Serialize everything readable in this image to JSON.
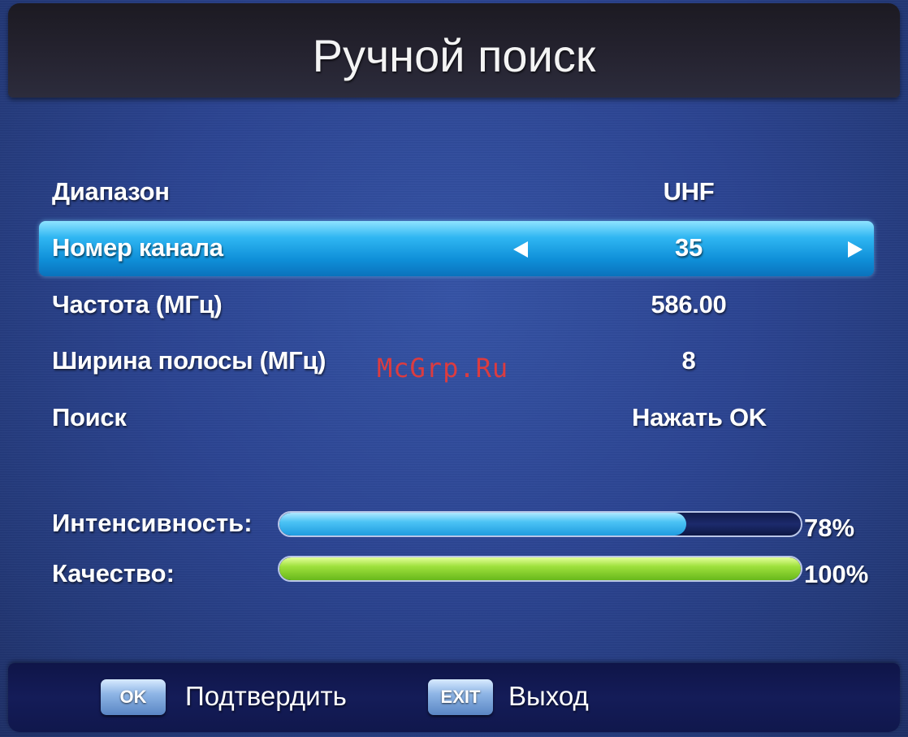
{
  "header": {
    "title": "Ручной поиск"
  },
  "settings": [
    {
      "label": "Диапазон",
      "value": "UHF"
    },
    {
      "label": "Номер канала",
      "value": "35"
    },
    {
      "label": "Частота (МГц)",
      "value": "586.00"
    },
    {
      "label": "Ширина полосы (МГц)",
      "value": "8"
    },
    {
      "label": "Поиск",
      "value": "Нажать OK"
    }
  ],
  "selected_row": 1,
  "watermark": "McGrp.Ru",
  "signal": {
    "intensity": {
      "label": "Интенсивность:",
      "percent_text": "78%",
      "level": 78,
      "color": "#4cc3f5"
    },
    "quality": {
      "label": "Качество:",
      "percent_text": "100%",
      "level": 100,
      "color": "#9ee03c"
    }
  },
  "footer": {
    "ok": {
      "key": "OK",
      "caption": "Подтвердить"
    },
    "exit": {
      "key": "EXIT",
      "caption": "Выход"
    }
  },
  "icons": {
    "left": "arrow-left-icon",
    "right": "arrow-right-icon"
  }
}
